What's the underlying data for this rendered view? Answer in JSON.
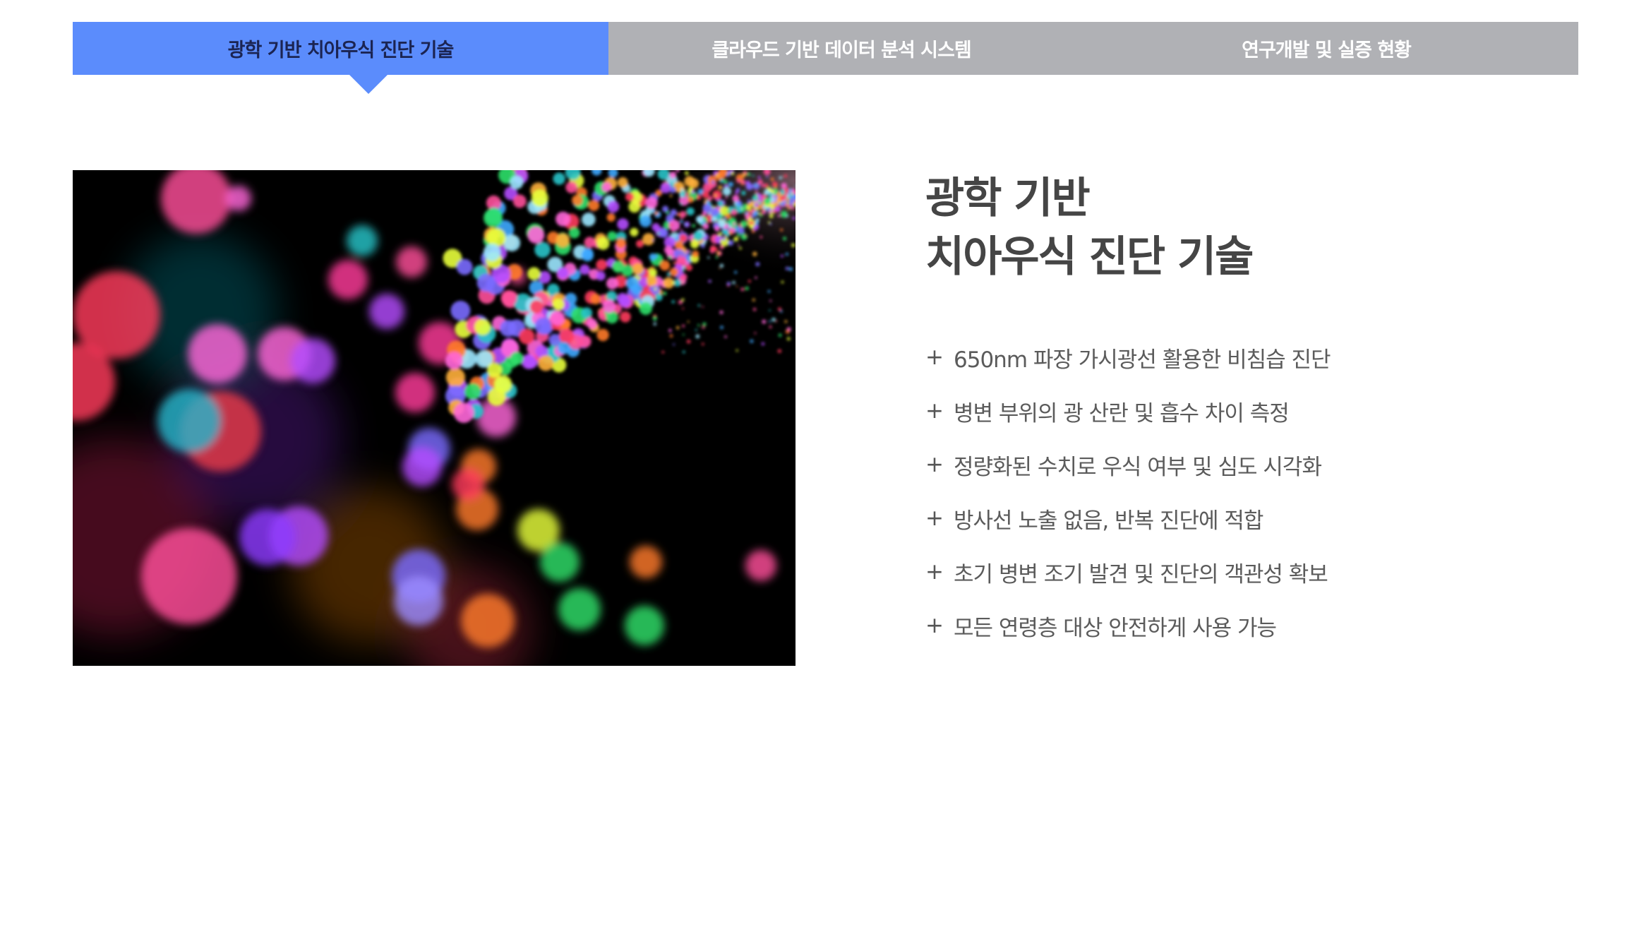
{
  "tabs": [
    {
      "label": "광학 기반 치아우식 진단 기술",
      "active": true
    },
    {
      "label": "클라우드 기반 데이터 분석 시스템",
      "active": false
    },
    {
      "label": "연구개발 및 실증 현황",
      "active": false
    }
  ],
  "colors": {
    "active_tab": "#5b8cfc",
    "inactive_tab": "#b0b1b5",
    "active_tab_text": "#1b2452",
    "heading": "#454545",
    "body_text": "#5b5b5b"
  },
  "content": {
    "title_line1": "광학 기반",
    "title_line2": "치아우식 진단 기술",
    "bullet_icon": "plus-icon",
    "features": [
      "650nm 파장 가시광선 활용한 비침습 진단",
      "병변 부위의 광 산란 및 흡수 차이 측정",
      "정량화된 수치로 우식 여부 및 심도 시각화",
      "방사선 노출 없음, 반복 진단에 적합",
      "초기 병변 조기 발견 및 진단의 객관성 확보",
      "모든 연령층 대상 안전하게 사용 가능"
    ]
  }
}
